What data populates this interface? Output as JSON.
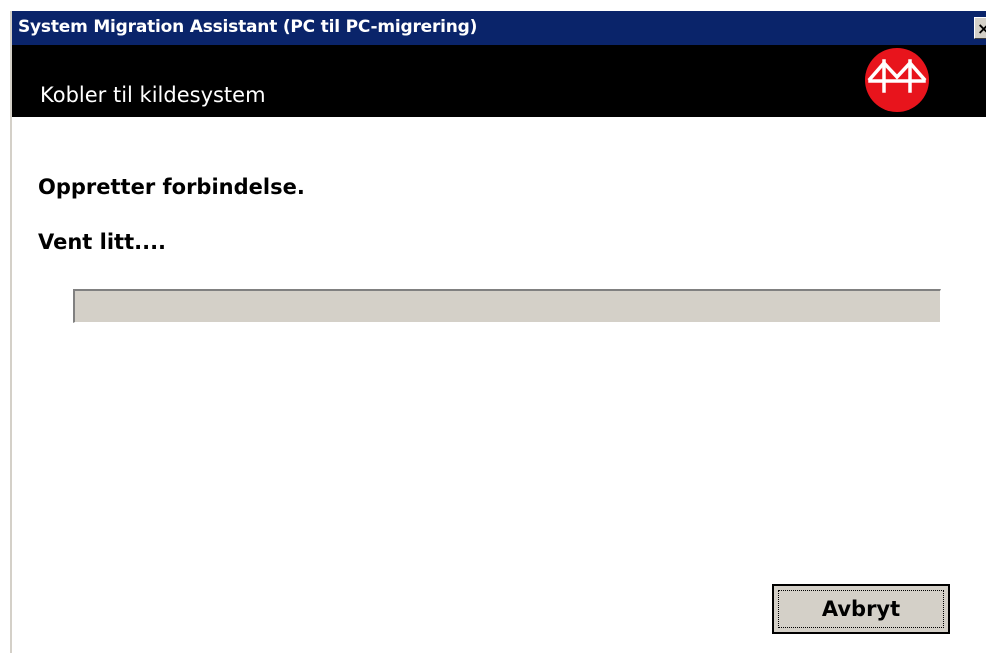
{
  "window": {
    "title": "System Migration Assistant (PC til PC-migrering)",
    "close_glyph": "×"
  },
  "header": {
    "subtitle": "Kobler til kildesystem",
    "logo_icon": "bridge-logo-icon",
    "logo_color": "#e8141c"
  },
  "status": {
    "line1": "Oppretter forbindelse.",
    "line2": "Vent litt...."
  },
  "progress": {
    "value": 0
  },
  "buttons": {
    "cancel_label": "Avbryt"
  },
  "colors": {
    "titlebar": "#0a246a",
    "header_bg": "#000000",
    "face": "#d4d0c8"
  }
}
